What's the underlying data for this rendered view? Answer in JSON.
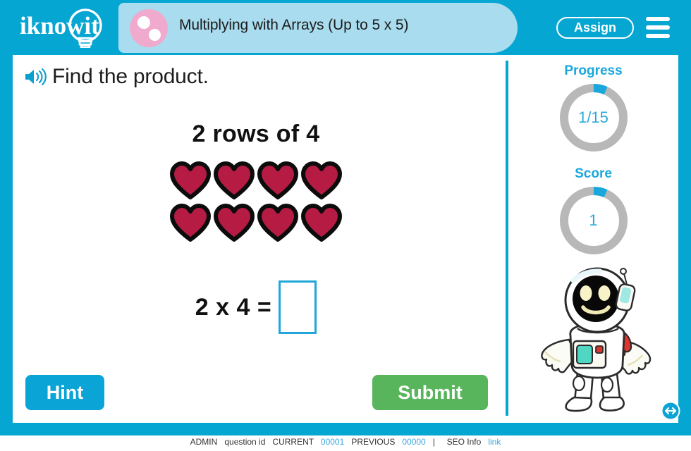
{
  "header": {
    "logo_text": "iknowit",
    "logo_icon": "lightbulb-icon",
    "topic_icon": "two-dots-circle-icon",
    "topic_title": "Multiplying with Arrays (Up to 5 x 5)",
    "assign_label": "Assign",
    "menu_icon": "hamburger-menu-icon"
  },
  "question": {
    "speaker_icon": "speaker-audio-icon",
    "instruction": "Find the product.",
    "prompt": "2 rows of 4",
    "rows": 2,
    "columns": 4,
    "object_icon": "heart-icon",
    "object_color": "#b51b43",
    "equation": "2 x 4 =",
    "answer_value": "",
    "answer_placeholder": ""
  },
  "actions": {
    "hint_label": "Hint",
    "submit_label": "Submit"
  },
  "meters": {
    "progress": {
      "label": "Progress",
      "value": "1/15",
      "current": 1,
      "total": 15,
      "percent": 6.67
    },
    "score": {
      "label": "Score",
      "value": "1",
      "percent": 6.67
    }
  },
  "mascot": {
    "name": "astronaut-mascot",
    "resize_icon": "resize-horizontal-icon"
  },
  "footer": {
    "admin_label": "ADMIN",
    "question_label": "question id",
    "current_label": "CURRENT",
    "current_value": "00001",
    "previous_label": "PREVIOUS",
    "previous_value": "00000",
    "separator": "|",
    "seo_label": "SEO Info",
    "seo_link": "link"
  },
  "colors": {
    "brand_cyan": "#06a6d3",
    "pill_blue": "#a9dcee",
    "pink": "#f0aacd",
    "green": "#58b55c",
    "heart_red": "#b51b43",
    "ring_track": "#b8b8b8",
    "ring_fill": "#19a7dc"
  }
}
